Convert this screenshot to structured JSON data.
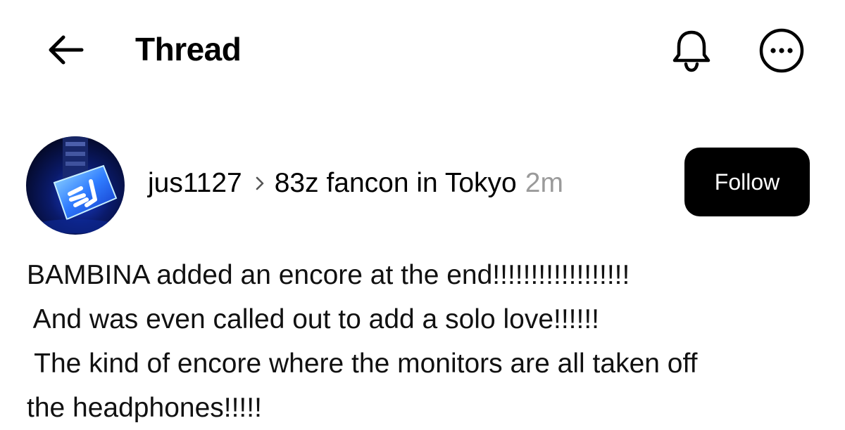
{
  "header": {
    "title": "Thread",
    "back_icon": "arrow-left-icon",
    "bell_icon": "bell-icon",
    "more_icon": "more-horizontal-circle-icon"
  },
  "post": {
    "username": "jus1127",
    "separator_icon": "chevron-right-icon",
    "community": "83z fancon in Tokyo",
    "timestamp": "2m",
    "follow_label": "Follow",
    "avatar_icon": "sj-lightstick-avatar",
    "body_lines": [
      "BAMBINA added an encore at the end!!!!!!!!!!!!!!!!!!",
      " And was even called out to add a solo love!!!!!!",
      " The kind of encore where the monitors are all taken off",
      "the headphones!!!!!"
    ]
  },
  "colors": {
    "accent": "#000000",
    "timestamp": "#9a9a9a",
    "background": "#ffffff"
  }
}
